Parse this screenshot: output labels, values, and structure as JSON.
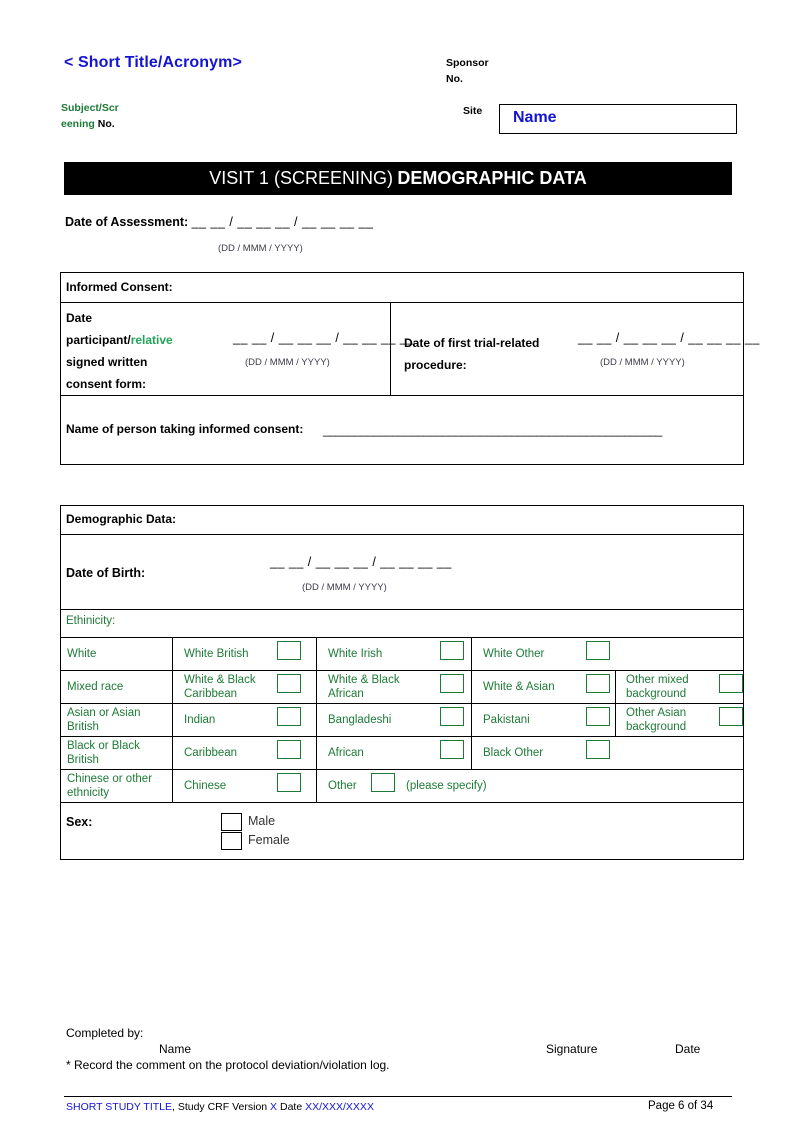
{
  "header": {
    "acronym": "< Short Title/Acronym>",
    "subject_label_green": "Subject/Scr",
    "subject_label_green2": "eening",
    "subject_label_black": "No.",
    "sponsor_line1": "Sponsor",
    "sponsor_line2": "No.",
    "site_label": "Site",
    "site_value": "Name"
  },
  "title_banner": {
    "visit": "VISIT 1 (SCREENING)",
    "section": "DEMOGRAPHIC DATA"
  },
  "assessment": {
    "label": "Date of Assessment:",
    "blanks": "__ __ / __ __ __ / __ __ __ __",
    "format_hint": "(DD /  MMM / YYYY)"
  },
  "informed_consent": {
    "section_title": "Informed Consent:",
    "signed_label_line1": "Date",
    "signed_label_line2a": "participant/",
    "signed_label_line2b": "relative",
    "signed_label_line3": "signed written",
    "signed_label_line4": "consent form:",
    "signed_blanks": "__ __ / __ __ __ / __ __ __ __",
    "signed_format_hint": "(DD /   MMM  / YYYY)",
    "first_procedure_label_line1": "Date of first trial-related",
    "first_procedure_label_line2": "procedure:",
    "first_procedure_blanks": "__ __ / __ __ __ / __ __ __ __",
    "first_procedure_format_hint": "(DD /   MMM  / YYYY)",
    "name_taking_label": "Name of person taking informed consent:",
    "name_taking_blank": "______________________________________________________"
  },
  "demographic": {
    "section_title": "Demographic Data:",
    "dob_label": "Date of Birth:",
    "dob_blanks": "__ __ / __ __ __ / __ __ __ __",
    "dob_format_hint": "(DD /  MMM / YYYY)",
    "ethnicity_label": "Ethinicity:",
    "ethnicity_rows": [
      {
        "group": "White",
        "options": [
          "White British",
          "White Irish",
          "White Other"
        ],
        "extra": null
      },
      {
        "group": "Mixed race",
        "options": [
          "White & Black Caribbean",
          "White & Black African",
          "White & Asian"
        ],
        "extra": "Other mixed background"
      },
      {
        "group": "Asian or Asian British",
        "options": [
          "Indian",
          "Bangladeshi",
          "Pakistani"
        ],
        "extra": "Other Asian background"
      },
      {
        "group": "Black or Black British",
        "options": [
          "Caribbean",
          "African",
          "Black Other"
        ],
        "extra": null
      },
      {
        "group": "Chinese or other ethnicity",
        "options": [
          "Chinese"
        ],
        "other_label": "Other",
        "other_specify": "(please specify)",
        "extra": null
      }
    ],
    "sex_label": "Sex:",
    "sex_options": [
      "Male",
      "Female"
    ]
  },
  "footer": {
    "completed_by": "Completed by:",
    "col_name": "Name",
    "col_signature": "Signature",
    "col_date": "Date",
    "note": "* Record the comment on the protocol deviation/violation log.",
    "study_title": "SHORT STUDY TITLE",
    "study_mid": ", Study CRF Version ",
    "study_version": "X",
    "study_date_label": " Date ",
    "study_date_value": "XX/XXX/XXXX",
    "page_text": "Page 6  of 34"
  }
}
